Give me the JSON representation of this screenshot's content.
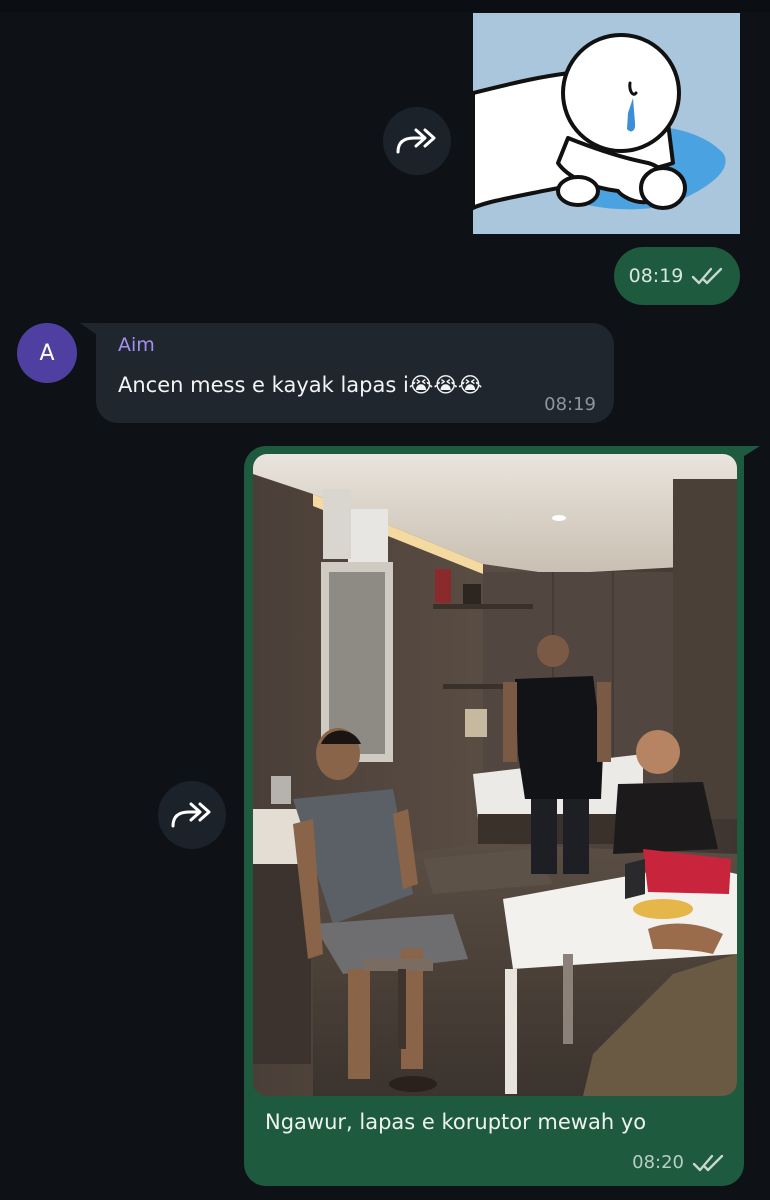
{
  "messages": [
    {
      "kind": "sticker",
      "direction": "outgoing",
      "sticker": "crying-figure",
      "time": "08:19",
      "status": "read"
    },
    {
      "kind": "text",
      "direction": "incoming",
      "avatar_letter": "A",
      "sender": "Aim",
      "text": "Ancen mess e kayak lapas i😭😭😭",
      "time": "08:19"
    },
    {
      "kind": "photo",
      "direction": "outgoing",
      "caption": "Ngawur, lapas e koruptor mewah yo",
      "time": "08:20",
      "status": "read"
    }
  ],
  "icons": {
    "forward": "forward-icon",
    "read_receipt": "double-check-icon"
  },
  "colors": {
    "background": "#0e1217",
    "outgoing_bubble": "#1d5a3e",
    "incoming_bubble": "#1f262d",
    "sender_name": "#a58ef0",
    "avatar": "#4f3fa0"
  }
}
